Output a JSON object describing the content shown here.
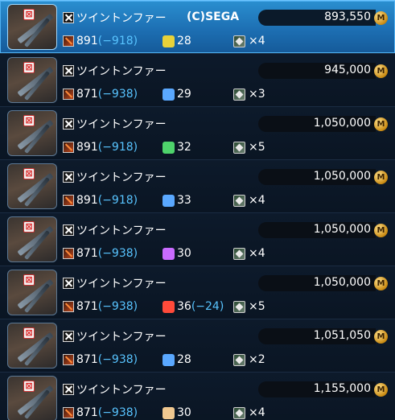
{
  "watermark": "(C)SEGA",
  "currency_icon": "meseta-coin-icon",
  "items": [
    {
      "name": "ツイントンファー",
      "atk": "891",
      "atk_diff": "(−918)",
      "element": {
        "icon": "lightning-icon",
        "color": "#e8d23a",
        "value": "28",
        "diff": ""
      },
      "slots": "×4",
      "price": "893,550",
      "selected": true
    },
    {
      "name": "ツイントンファー",
      "atk": "871",
      "atk_diff": "(−938)",
      "element": {
        "icon": "light-icon",
        "color": "#5aa8ff",
        "value": "29",
        "diff": ""
      },
      "slots": "×3",
      "price": "945,000",
      "selected": false
    },
    {
      "name": "ツイントンファー",
      "atk": "891",
      "atk_diff": "(−918)",
      "element": {
        "icon": "wind-icon",
        "color": "#4ed36b",
        "value": "32",
        "diff": ""
      },
      "slots": "×5",
      "price": "1,050,000",
      "selected": false
    },
    {
      "name": "ツイントンファー",
      "atk": "891",
      "atk_diff": "(−918)",
      "element": {
        "icon": "light-icon",
        "color": "#5aa8ff",
        "value": "33",
        "diff": ""
      },
      "slots": "×4",
      "price": "1,050,000",
      "selected": false
    },
    {
      "name": "ツイントンファー",
      "atk": "871",
      "atk_diff": "(−938)",
      "element": {
        "icon": "dark-icon",
        "color": "#c96bff",
        "value": "30",
        "diff": ""
      },
      "slots": "×4",
      "price": "1,050,000",
      "selected": false
    },
    {
      "name": "ツイントンファー",
      "atk": "871",
      "atk_diff": "(−938)",
      "element": {
        "icon": "fire-icon",
        "color": "#ff4a3a",
        "value": "36",
        "diff": "(−24)"
      },
      "slots": "×5",
      "price": "1,050,000",
      "selected": false
    },
    {
      "name": "ツイントンファー",
      "atk": "871",
      "atk_diff": "(−938)",
      "element": {
        "icon": "light-icon",
        "color": "#5aa8ff",
        "value": "28",
        "diff": ""
      },
      "slots": "×2",
      "price": "1,051,050",
      "selected": false
    },
    {
      "name": "ツイントンファー",
      "atk": "871",
      "atk_diff": "(−938)",
      "element": {
        "icon": "ice-icon",
        "color": "#f0c890",
        "value": "30",
        "diff": ""
      },
      "slots": "×4",
      "price": "1,155,000",
      "selected": false
    }
  ]
}
